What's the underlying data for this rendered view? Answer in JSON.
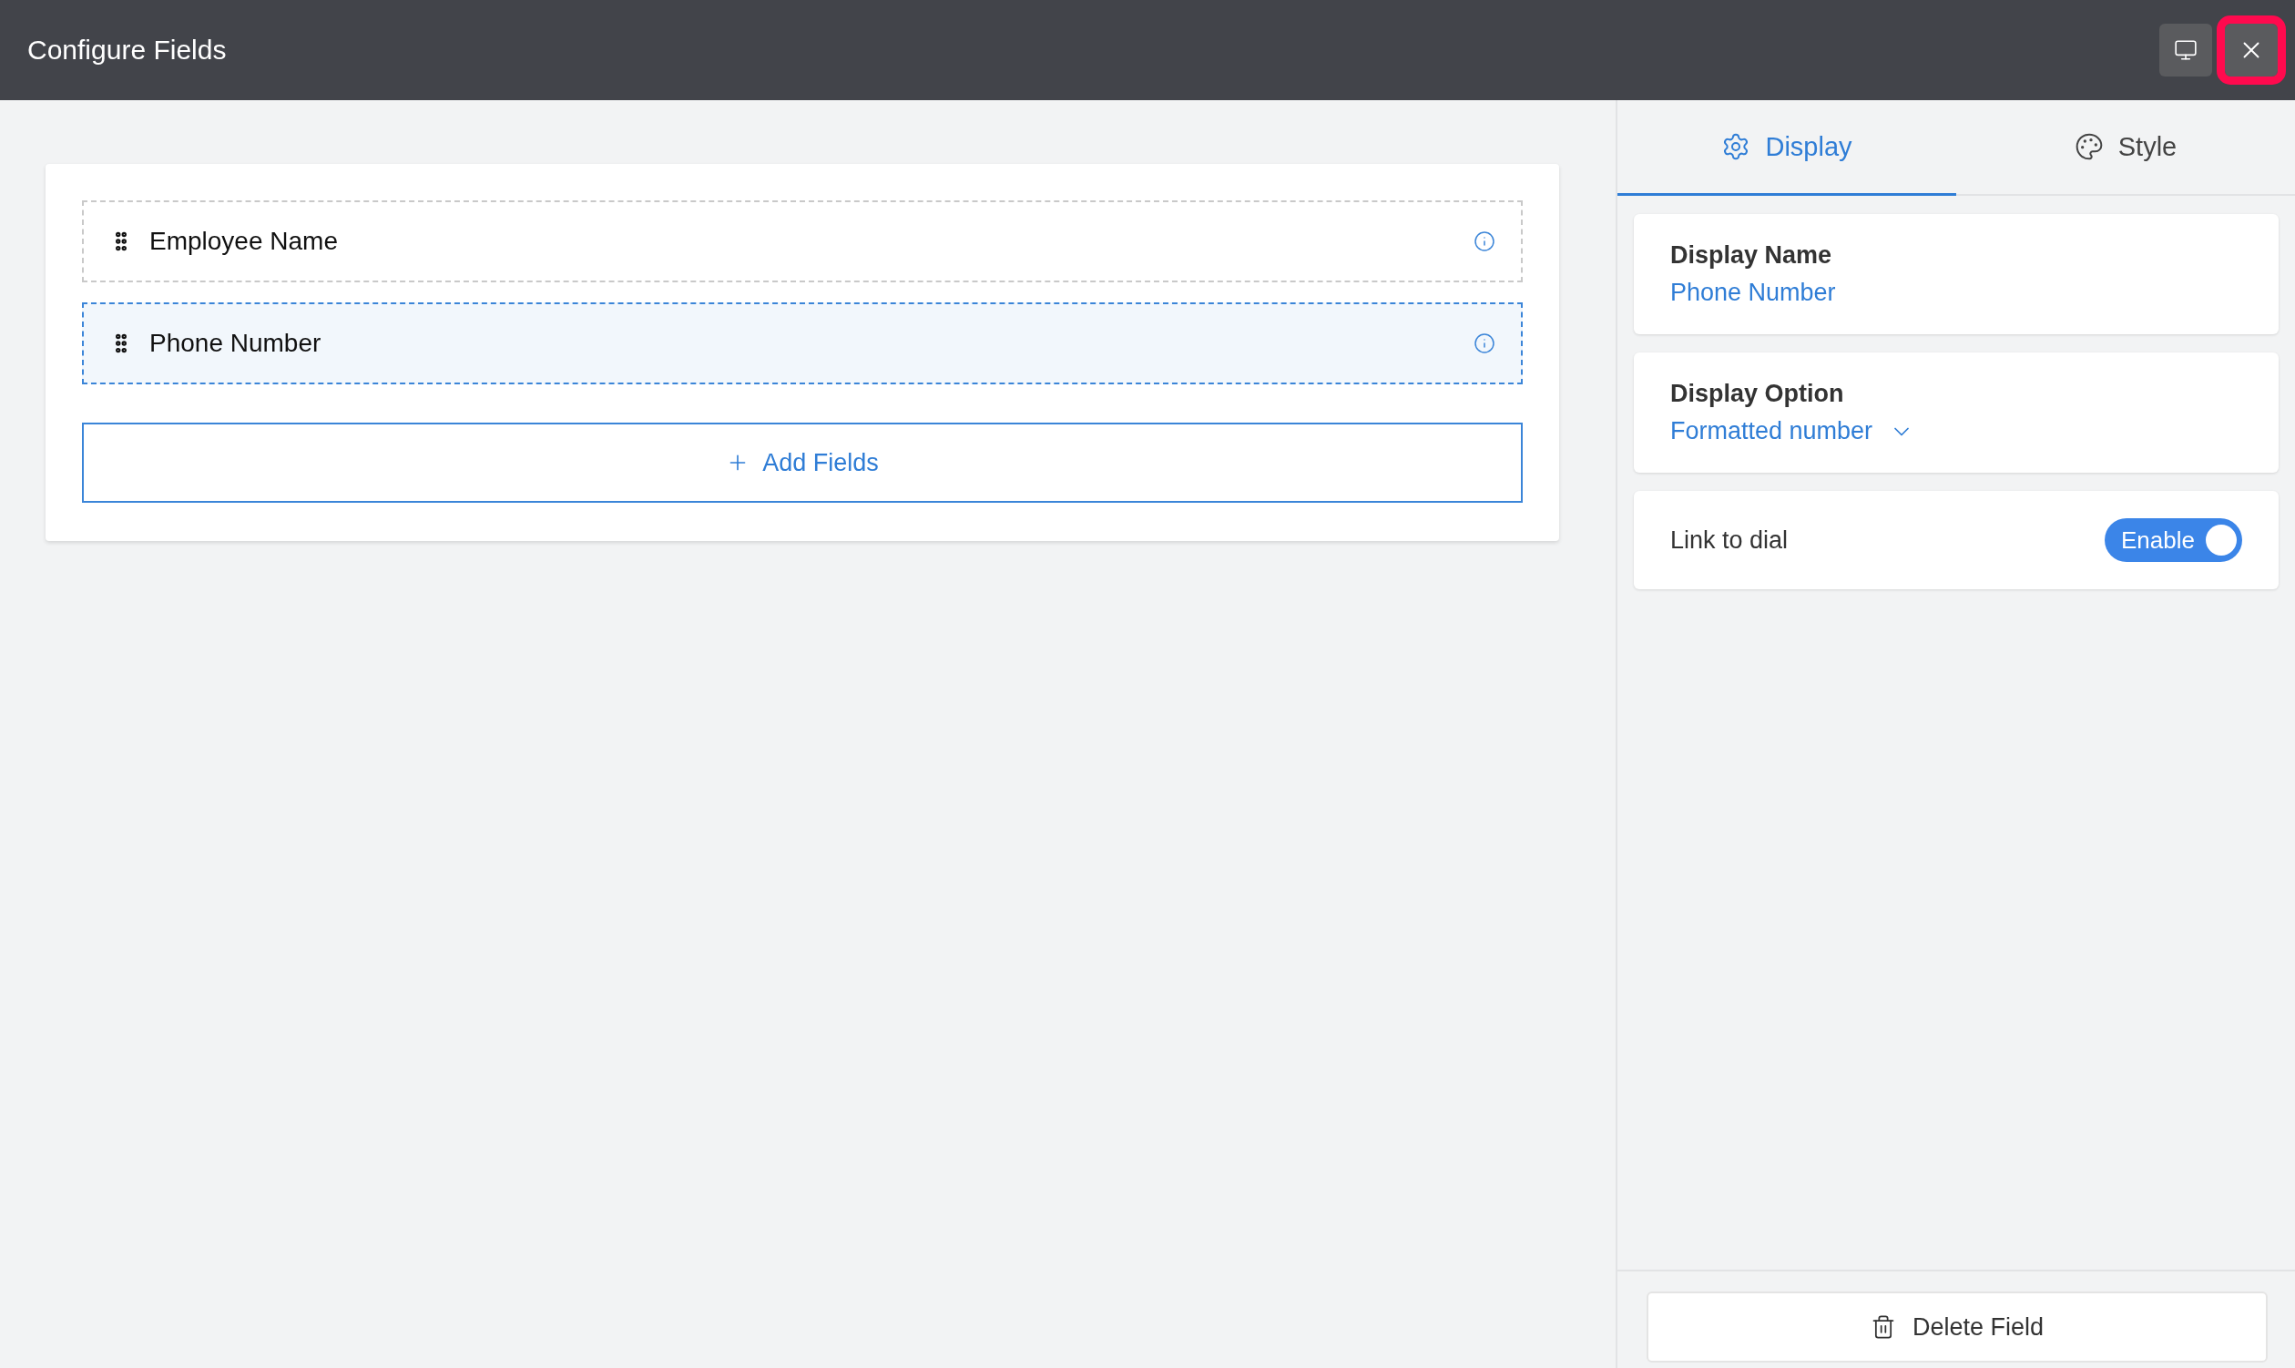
{
  "window": {
    "title": "Configure Fields",
    "buttons": [
      {
        "kind": "screen",
        "highlighted": false
      },
      {
        "kind": "close",
        "highlighted": true
      }
    ]
  },
  "fields": [
    {
      "label": "Employee Name",
      "selected": false
    },
    {
      "label": "Phone Number",
      "selected": true
    }
  ],
  "add_button": {
    "label": "Add Fields"
  },
  "tabs": [
    {
      "label": "Display",
      "kind": "gear",
      "selected": true
    },
    {
      "label": "Style",
      "kind": "palette",
      "selected": false
    }
  ],
  "settings": [
    {
      "kind": "value",
      "label": "Display Name",
      "value": "Phone Number"
    },
    {
      "kind": "dropdown",
      "label": "Display Option",
      "value": "Formatted number"
    },
    {
      "kind": "toggle",
      "label": "Link to dial",
      "toggle_label": "Enable",
      "on": true
    }
  ],
  "delete_button": {
    "label": "Delete Field"
  }
}
